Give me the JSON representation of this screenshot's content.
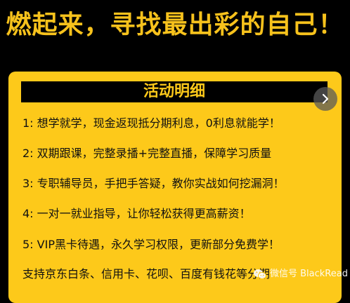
{
  "headline": "燃起来，寻找最出彩的自己！",
  "card": {
    "title": "活动明细",
    "items": [
      "1:  想学就学，现金返现抵分期利息，0利息就能学！",
      "2:  双期跟课，完整录播+完整直播，保障学习质量",
      "3:  专职辅导员，手把手答疑，教你实战如何挖漏洞！",
      "4:  一对一就业指导，让你轻松获得更高薪资！",
      "5:  VIP黑卡待遇，永久学习权限，更新部分免费学！"
    ],
    "footer": "支持京东白条、信用卡、花呗、百度有钱花等分期"
  },
  "watermark": {
    "icon": "wechat-icon",
    "text": "微信号 BlackRead"
  },
  "colors": {
    "accent": "#fdc91a",
    "background": "#000000",
    "text": "#111111"
  }
}
